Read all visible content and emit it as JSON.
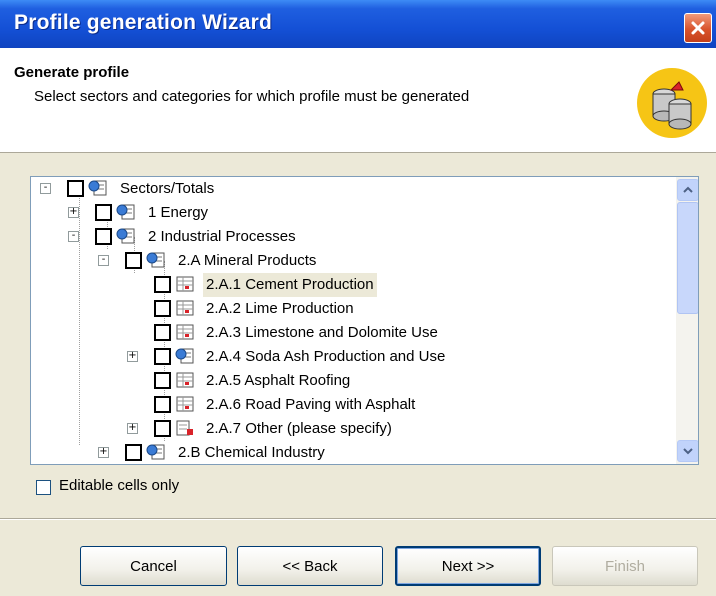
{
  "window": {
    "title": "Profile generation Wizard"
  },
  "header": {
    "title": "Generate profile",
    "subtitle": "Select sectors and categories for which profile must be generated"
  },
  "tree": {
    "nodes": [
      {
        "label": "Sectors/Totals",
        "toggle": "-",
        "icon": "sector-icon"
      },
      {
        "label": "1 Energy",
        "toggle": "+",
        "icon": "sector-icon"
      },
      {
        "label": "2 Industrial Processes",
        "toggle": "-",
        "icon": "sector-icon"
      },
      {
        "label": "2.A Mineral Products",
        "toggle": "-",
        "icon": "sector-icon"
      },
      {
        "label": "2.A.1 Cement Production",
        "toggle": "",
        "icon": "table-icon",
        "selected": true
      },
      {
        "label": "2.A.2 Lime Production",
        "toggle": "",
        "icon": "table-icon"
      },
      {
        "label": "2.A.3 Limestone and Dolomite Use",
        "toggle": "",
        "icon": "table-icon"
      },
      {
        "label": "2.A.4 Soda Ash Production and Use",
        "toggle": "+",
        "icon": "sector-icon"
      },
      {
        "label": "2.A.5 Asphalt Roofing",
        "toggle": "",
        "icon": "table-icon"
      },
      {
        "label": "2.A.6 Road Paving with Asphalt",
        "toggle": "",
        "icon": "table-icon"
      },
      {
        "label": "2.A.7 Other (please specify)",
        "toggle": "+",
        "icon": "other-icon"
      },
      {
        "label": "2.B Chemical Industry",
        "toggle": "+",
        "icon": "sector-icon"
      }
    ]
  },
  "options": {
    "editable_label": "Editable cells only",
    "editable_checked": false
  },
  "buttons": {
    "cancel": "Cancel",
    "back": "<< Back",
    "next": "Next >>",
    "finish": "Finish"
  },
  "colors": {
    "titlebar": "#1450d6",
    "close": "#d9532c",
    "selection": "#ece9d8",
    "header_icon": "#f6c515"
  }
}
